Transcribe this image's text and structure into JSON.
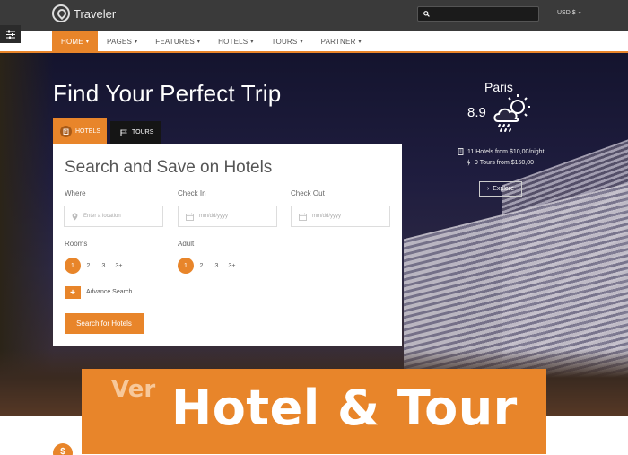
{
  "header": {
    "logo_text": "Traveler",
    "search": {
      "placeholder": ""
    },
    "currency": "USD $"
  },
  "nav": {
    "items": [
      {
        "label": "HOME",
        "active": true
      },
      {
        "label": "PAGES"
      },
      {
        "label": "FEATURES"
      },
      {
        "label": "HOTELS"
      },
      {
        "label": "TOURS"
      },
      {
        "label": "PARTNER"
      }
    ]
  },
  "hero": {
    "title": "Find Your Perfect Trip",
    "tabs": [
      {
        "label": "HOTELS",
        "icon": "hotel-icon",
        "active": true
      },
      {
        "label": "TOURS",
        "icon": "flag-icon"
      }
    ]
  },
  "form": {
    "title": "Search and Save on Hotels",
    "where_label": "Where",
    "where_placeholder": "Enter a location",
    "checkin_label": "Check In",
    "checkin_placeholder": "mm/dd/yyyy",
    "checkout_label": "Check Out",
    "checkout_placeholder": "mm/dd/yyyy",
    "rooms_label": "Rooms",
    "rooms_options": [
      "1",
      "2",
      "3",
      "3+"
    ],
    "rooms_selected": "1",
    "adult_label": "Adult",
    "adult_options": [
      "1",
      "2",
      "3",
      "3+"
    ],
    "adult_selected": "1",
    "advance_label": "Advance Search",
    "advance_icon": "+",
    "submit_label": "Search for Hotels"
  },
  "weather": {
    "city": "Paris",
    "temperature": "8.9",
    "icon": "rain-cloud-sun-icon",
    "hotels_stat": "11 Hotels from $10,00/night",
    "tours_stat": "9 Tours from $150,00",
    "explore_label": "Explore"
  },
  "banner": {
    "prefix": "Ver",
    "main": "Hotel & Tour"
  },
  "footer": {
    "badge": "$"
  },
  "colors": {
    "accent": "#e8852a",
    "topbar": "#3a3a3a"
  }
}
